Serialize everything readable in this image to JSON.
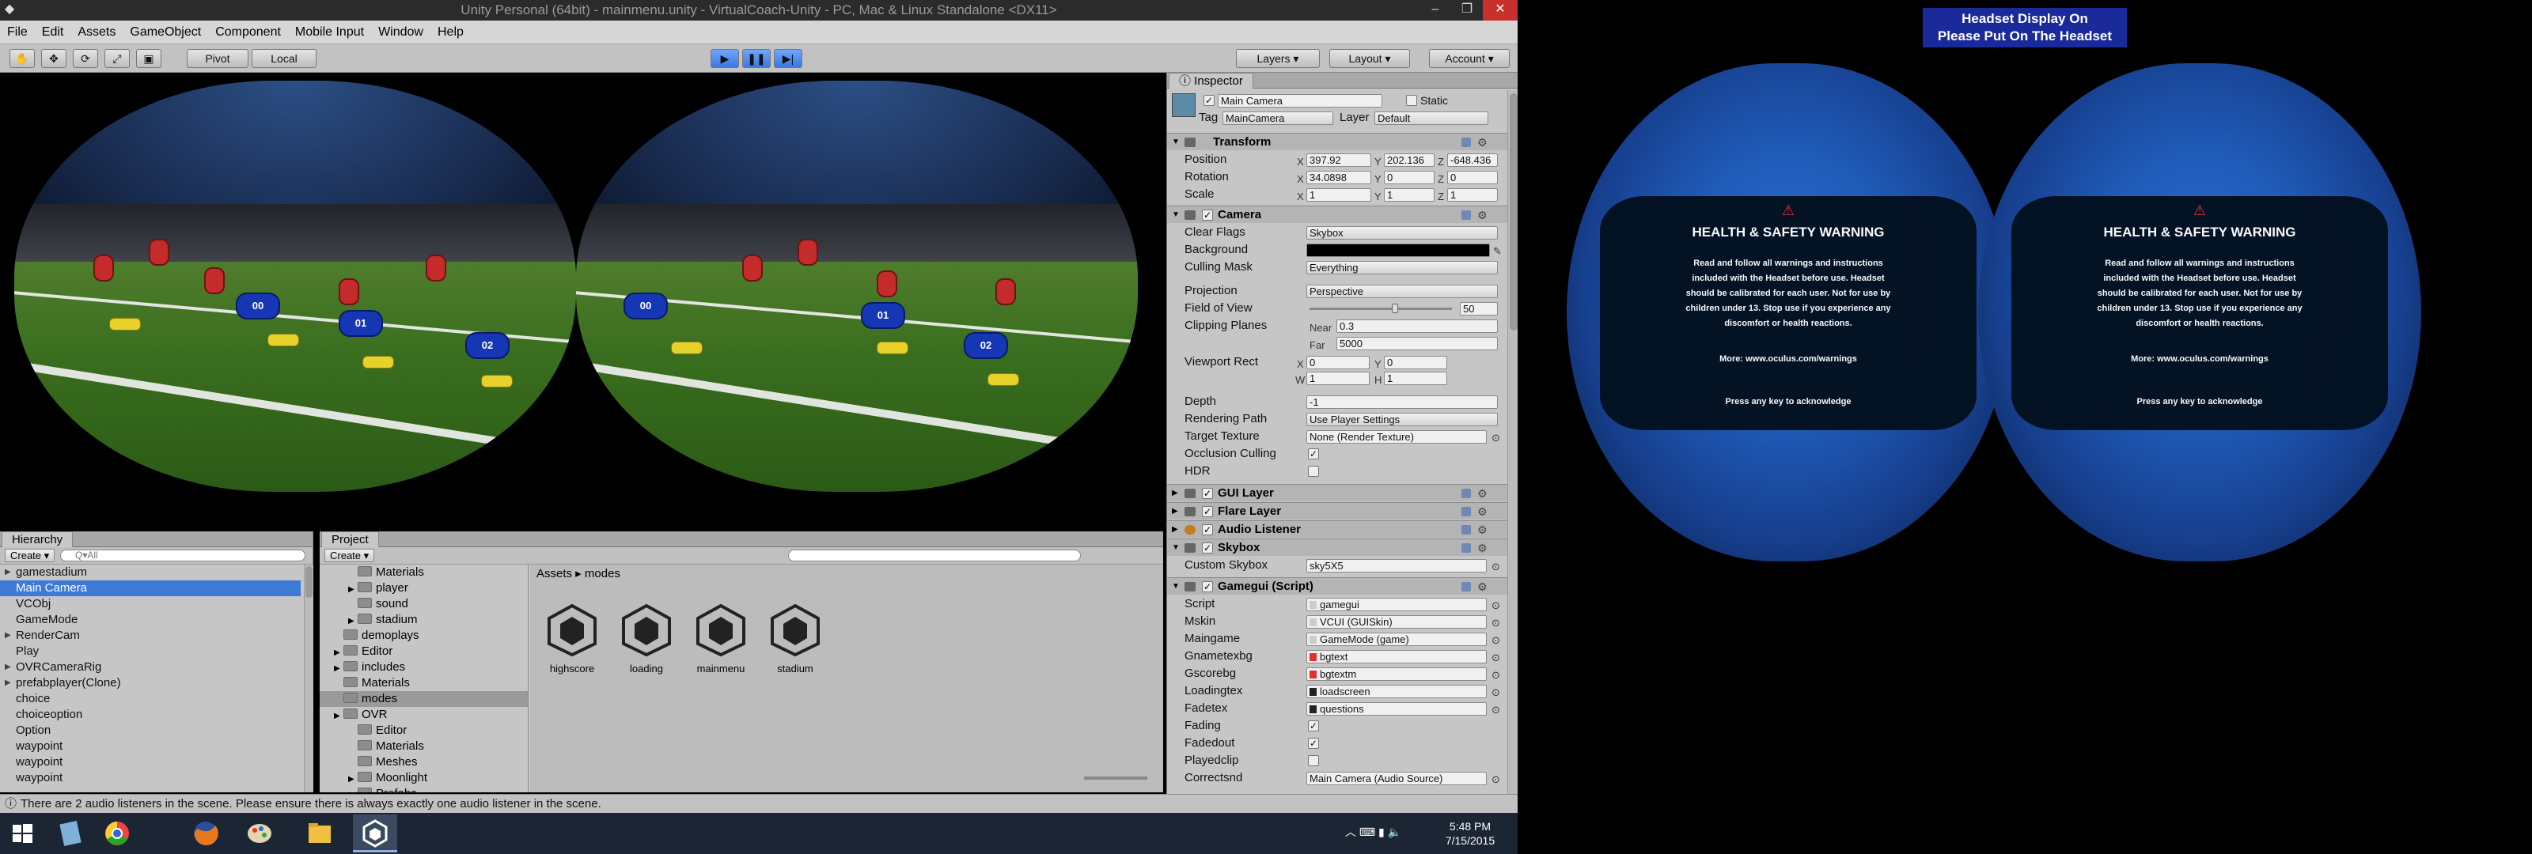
{
  "window": {
    "title": "Unity Personal (64bit) - mainmenu.unity - VirtualCoach-Unity - PC, Mac & Linux Standalone <DX11>"
  },
  "menu": [
    "File",
    "Edit",
    "Assets",
    "GameObject",
    "Component",
    "Mobile Input",
    "Window",
    "Help"
  ],
  "toolbar": {
    "pivot": "Pivot",
    "local": "Local",
    "layers": "Layers",
    "layout": "Layout",
    "account": "Account"
  },
  "game": {
    "players": [
      "00",
      "01",
      "02"
    ]
  },
  "hierarchy": {
    "tab": "Hierarchy",
    "create": "Create",
    "search_placeholder": "Q▾All",
    "items": [
      {
        "label": "gamestadium",
        "expand": true,
        "selected": false
      },
      {
        "label": "Main Camera",
        "expand": false,
        "selected": true
      },
      {
        "label": "VCObj",
        "expand": false,
        "selected": false
      },
      {
        "label": "GameMode",
        "expand": false,
        "selected": false
      },
      {
        "label": "RenderCam",
        "expand": true,
        "selected": false
      },
      {
        "label": "Play",
        "expand": false,
        "selected": false
      },
      {
        "label": "OVRCameraRig",
        "expand": true,
        "selected": false
      },
      {
        "label": "prefabplayer(Clone)",
        "expand": true,
        "selected": false
      },
      {
        "label": "choice",
        "expand": false,
        "selected": false
      },
      {
        "label": "choiceoption",
        "expand": false,
        "selected": false
      },
      {
        "label": "Option",
        "expand": false,
        "selected": false
      },
      {
        "label": "waypoint",
        "expand": false,
        "selected": false
      },
      {
        "label": "waypoint",
        "expand": false,
        "selected": false
      },
      {
        "label": "waypoint",
        "expand": false,
        "selected": false
      }
    ]
  },
  "project": {
    "tab": "Project",
    "create": "Create",
    "breadcrumb": [
      "Assets",
      "modes"
    ],
    "tree": [
      {
        "label": "Materials",
        "indent": 2,
        "arrow": false,
        "sel": false
      },
      {
        "label": "player",
        "indent": 2,
        "arrow": true,
        "sel": false
      },
      {
        "label": "sound",
        "indent": 2,
        "arrow": false,
        "sel": false
      },
      {
        "label": "stadium",
        "indent": 2,
        "arrow": true,
        "sel": false
      },
      {
        "label": "demoplays",
        "indent": 1,
        "arrow": false,
        "sel": false
      },
      {
        "label": "Editor",
        "indent": 1,
        "arrow": true,
        "sel": false
      },
      {
        "label": "includes",
        "indent": 1,
        "arrow": true,
        "sel": false
      },
      {
        "label": "Materials",
        "indent": 1,
        "arrow": false,
        "sel": false
      },
      {
        "label": "modes",
        "indent": 1,
        "arrow": false,
        "sel": true
      },
      {
        "label": "OVR",
        "indent": 1,
        "arrow": true,
        "sel": false
      },
      {
        "label": "Editor",
        "indent": 2,
        "arrow": false,
        "sel": false
      },
      {
        "label": "Materials",
        "indent": 2,
        "arrow": false,
        "sel": false
      },
      {
        "label": "Meshes",
        "indent": 2,
        "arrow": false,
        "sel": false
      },
      {
        "label": "Moonlight",
        "indent": 2,
        "arrow": true,
        "sel": false
      },
      {
        "label": "Prefabs",
        "indent": 2,
        "arrow": false,
        "sel": false
      }
    ],
    "assets": [
      "highscore",
      "loading",
      "mainmenu",
      "stadium"
    ]
  },
  "status": "There are 2 audio listeners in the scene. Please ensure there is always exactly one audio listener in the scene.",
  "inspector": {
    "tab": "Inspector",
    "name": "Main Camera",
    "static": "Static",
    "tag_label": "Tag",
    "tag": "MainCamera",
    "layer_label": "Layer",
    "layer": "Default",
    "transform": {
      "title": "Transform",
      "position": {
        "label": "Position",
        "x": "397.92",
        "y": "202.136",
        "z": "-648.436"
      },
      "rotation": {
        "label": "Rotation",
        "x": "34.0898",
        "y": "0",
        "z": "0"
      },
      "scale": {
        "label": "Scale",
        "x": "1",
        "y": "1",
        "z": "1"
      }
    },
    "camera": {
      "title": "Camera",
      "clear_flags": {
        "label": "Clear Flags",
        "value": "Skybox"
      },
      "background": {
        "label": "Background"
      },
      "culling": {
        "label": "Culling Mask",
        "value": "Everything"
      },
      "projection": {
        "label": "Projection",
        "value": "Perspective"
      },
      "fov": {
        "label": "Field of View",
        "value": "50"
      },
      "clipping": {
        "label": "Clipping Planes",
        "near_label": "Near",
        "near": "0.3",
        "far_label": "Far",
        "far": "5000"
      },
      "viewport": {
        "label": "Viewport Rect",
        "x": "0",
        "y": "0",
        "w": "1",
        "h": "1"
      },
      "depth": {
        "label": "Depth",
        "value": "-1"
      },
      "rendering": {
        "label": "Rendering Path",
        "value": "Use Player Settings"
      },
      "target": {
        "label": "Target Texture",
        "value": "None (Render Texture)"
      },
      "occlusion": {
        "label": "Occlusion Culling"
      },
      "hdr": {
        "label": "HDR"
      }
    },
    "gui_layer": "GUI Layer",
    "flare_layer": "Flare Layer",
    "audio_listener": "Audio Listener",
    "skybox": {
      "title": "Skybox",
      "custom_label": "Custom Skybox",
      "custom": "sky5X5"
    },
    "gamegui": {
      "title": "Gamegui (Script)",
      "rows": [
        {
          "label": "Script",
          "value": "gamegui"
        },
        {
          "label": "Mskin",
          "value": "VCUI (GUISkin)"
        },
        {
          "label": "Maingame",
          "value": "GameMode (game)"
        },
        {
          "label": "Gnametexbg",
          "value": "bgtext"
        },
        {
          "label": "Gscorebg",
          "value": "bgtextm"
        },
        {
          "label": "Loadingtex",
          "value": "loadscreen"
        },
        {
          "label": "Fadetex",
          "value": "questions"
        }
      ],
      "fading": "Fading",
      "fadedout": "Fadedout",
      "playedclip": "Playedclip",
      "correctsnd": {
        "label": "Correctsnd",
        "value": "Main Camera (Audio Source)"
      }
    }
  },
  "taskbar": {
    "time": "5:48 PM",
    "date": "7/15/2015"
  },
  "vr": {
    "banner_line1": "Headset Display On",
    "banner_line2": "Please Put On The Headset",
    "warning_title": "HEALTH & SAFETY WARNING",
    "warning_body": [
      "Read and follow all warnings and instructions",
      "included with the Headset before use. Headset",
      "should be calibrated for each user. Not for use by",
      "children under 13. Stop use if you experience any",
      "discomfort or health reactions."
    ],
    "more": "More: www.oculus.com/warnings",
    "press": "Press any key to acknowledge"
  }
}
